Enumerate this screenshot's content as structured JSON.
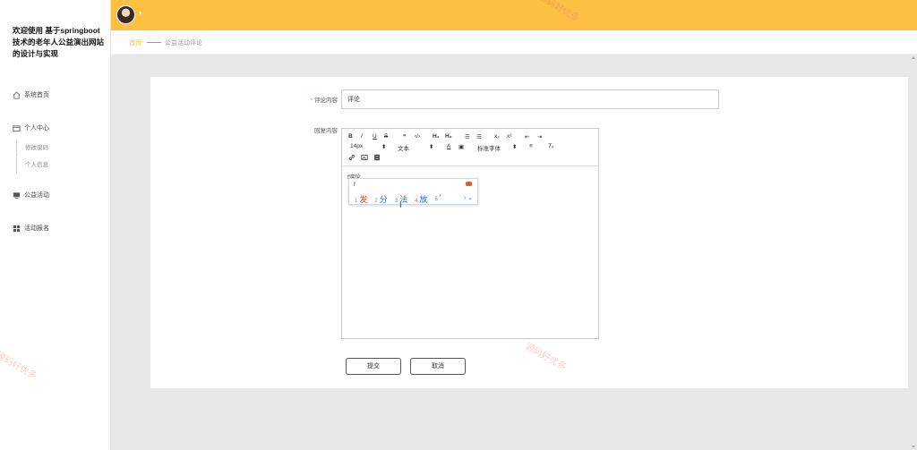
{
  "sidebar": {
    "welcome": "欢迎使用 基于springboot技术的老年人公益演出网站的设计与实现",
    "items": [
      {
        "label": "系统首页",
        "icon": "home-icon"
      },
      {
        "label": "个人中心",
        "icon": "profile-icon"
      },
      {
        "label": "公益活动",
        "icon": "monitor-icon"
      },
      {
        "label": "活动报名",
        "icon": "grid-icon"
      }
    ],
    "sub_items": [
      "修改密码",
      "个人信息"
    ]
  },
  "header": {
    "avatar_icon": "user-avatar",
    "caret": "▾"
  },
  "breadcrumb": {
    "home": "首页",
    "current": "公益活动评论"
  },
  "form": {
    "comment_label": "评论内容",
    "comment_value": "评论",
    "reply_label": "回复内容",
    "required_mark": "*"
  },
  "editor": {
    "toolbar": {
      "bold": "B",
      "italic": "I",
      "underline": "U",
      "strike": "S",
      "quote": "❞",
      "code": "‹/›",
      "h1": "H₁",
      "h2": "H₂",
      "ol": "☰",
      "ul": "☰",
      "sub": "x₂",
      "sup": "x²",
      "outdent": "⇤",
      "indent": "⇥",
      "size": "14px",
      "text_type": "文本",
      "font": "标准字体",
      "link_icon": "link-icon",
      "image_icon": "image-icon",
      "video_icon": "video-icon"
    },
    "content": "f评论"
  },
  "ime": {
    "composition": "f",
    "candidates": [
      {
        "n": "1",
        "w": "发"
      },
      {
        "n": "2",
        "w": "分"
      },
      {
        "n": "3",
        "w": "法"
      },
      {
        "n": "4",
        "w": "放"
      },
      {
        "n": "5",
        "w": "'"
      }
    ],
    "nav": "› ⌄"
  },
  "buttons": {
    "submit": "提交",
    "cancel": "取消"
  },
  "watermark": "源码好优多",
  "colors": {
    "accent": "#fdc042",
    "required": "#f56c6c",
    "ime_first": "#e0402b",
    "ime_link": "#2a6bd1"
  }
}
